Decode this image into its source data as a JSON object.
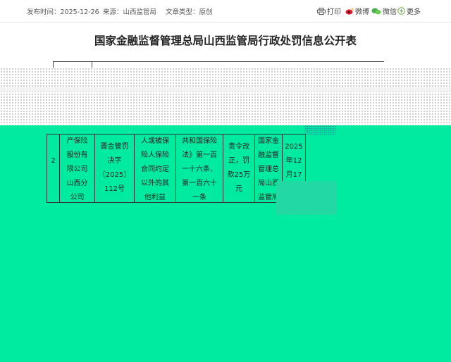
{
  "meta": {
    "publish_label": "发布时间：",
    "publish_date": "2025-12-26",
    "source_label": "来源：",
    "source": "山西监管局",
    "type_label": "文章类型：",
    "type": "原创"
  },
  "share": {
    "print": "打印",
    "weibo": "微博",
    "wechat": "微信",
    "more": "更多"
  },
  "page_title": "国家金融监督管理总局山西监管局行政处罚信息公开表",
  "table": {
    "row": {
      "index": "2",
      "party_name": [
        "产保险",
        "股份有",
        "限公司",
        "山西分",
        "公司"
      ],
      "decision_no": [
        "晋金管罚",
        "决字",
        "〔2025〕",
        "112号"
      ],
      "violation": [
        "人或被保",
        "险人保险",
        "合同约定",
        "以外的其",
        "他利益"
      ],
      "basis": [
        "共和国保险",
        "法》第一百",
        "一十六条、",
        "第一百六十",
        "一条"
      ],
      "decision": [
        "责令改",
        "正，罚",
        "款25万",
        "元"
      ],
      "authority": [
        "国家金",
        "融监督",
        "管理总",
        "局山西",
        "监管局"
      ],
      "date": [
        "2025",
        "年12",
        "月17",
        "日"
      ]
    }
  }
}
